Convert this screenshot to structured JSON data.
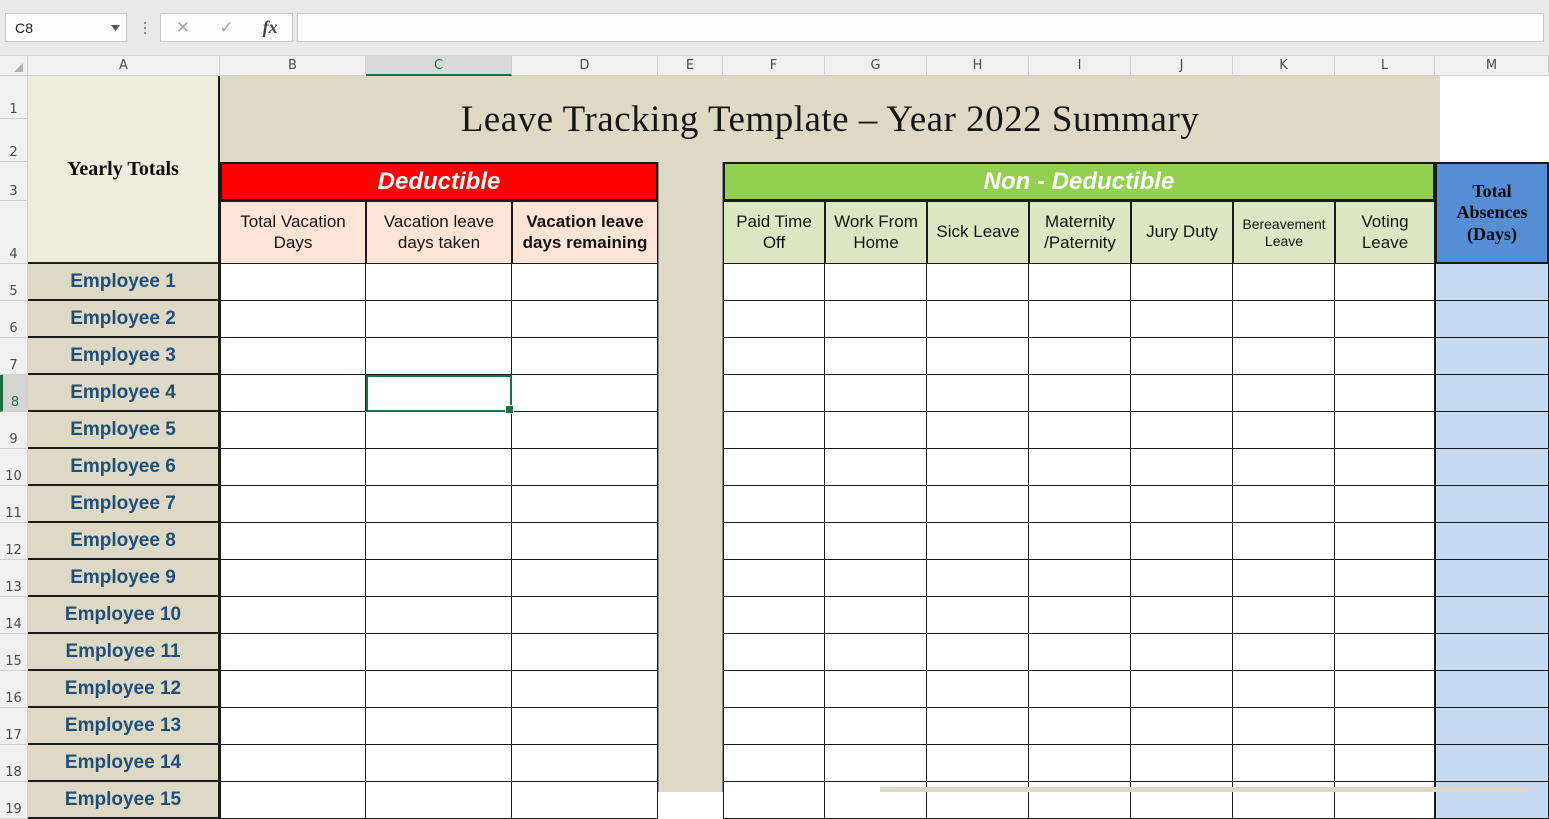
{
  "formula_bar": {
    "name_box_value": "C8",
    "formula_value": "",
    "formula_placeholder": "",
    "cancel_label": "✕",
    "confirm_label": "✓",
    "fx_label": "fx"
  },
  "grid": {
    "column_headers": [
      "A",
      "B",
      "C",
      "D",
      "E",
      "F",
      "G",
      "H",
      "I",
      "J",
      "K",
      "L",
      "M"
    ],
    "active_column": "C",
    "active_row": "8",
    "active_cell": "C8",
    "row_headers": [
      "1",
      "2",
      "3",
      "4",
      "5",
      "6",
      "7",
      "8",
      "9",
      "10",
      "11",
      "12",
      "13",
      "14",
      "15",
      "16",
      "17",
      "18",
      "19"
    ]
  },
  "sheet": {
    "title": "Leave Tracking Template – Year 2022 Summary",
    "yearly_totals_label": "Yearly Totals",
    "group_deductible": "Deductible",
    "group_non_deductible": "Non - Deductible",
    "total_absences_label": "Total Absences (Days)",
    "deductible_columns": [
      {
        "label": "Total Vacation Days",
        "bold": false
      },
      {
        "label": "Vacation leave days taken",
        "bold": false
      },
      {
        "label": "Vacation leave days remaining",
        "bold": true
      }
    ],
    "non_deductible_columns": [
      {
        "label": "Paid Time Off",
        "small": false
      },
      {
        "label": "Work From Home",
        "small": false
      },
      {
        "label": "Sick Leave",
        "small": false
      },
      {
        "label": "Maternity /Paternity",
        "small": false
      },
      {
        "label": "Jury Duty",
        "small": false
      },
      {
        "label": "Bereavement Leave",
        "small": true
      },
      {
        "label": "Voting Leave",
        "small": false
      }
    ],
    "employees": [
      "Employee 1",
      "Employee 2",
      "Employee 3",
      "Employee 4",
      "Employee 5",
      "Employee 6",
      "Employee 7",
      "Employee 8",
      "Employee 9",
      "Employee 10",
      "Employee 11",
      "Employee 12",
      "Employee 13",
      "Employee 14",
      "Employee 15"
    ]
  },
  "colors": {
    "deductible_band": "#FF0000",
    "non_deductible_band": "#92D050",
    "total_absences_header": "#558ED5",
    "total_absences_cells": "#C5D9F1",
    "title_band": "#DDD9C4",
    "employee_cell": "#DDD9C4",
    "deductible_subheader": "#FCE4D6",
    "non_deductible_subheader": "#DBE7C3",
    "yearly_totals_cell": "#EEEDDC",
    "employee_text": "#1F4E79",
    "selection": "#1D7044"
  }
}
